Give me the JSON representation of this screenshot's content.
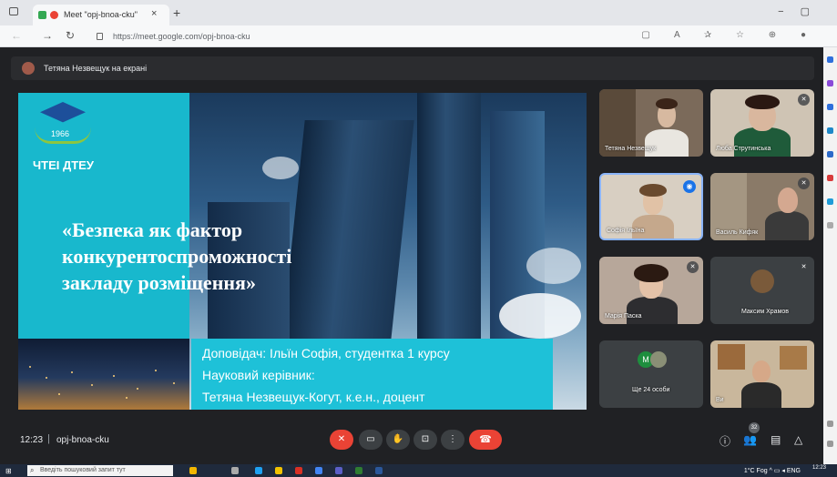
{
  "browser": {
    "tab_title": "Meet \"opj-bnoa-cku\"",
    "url": "https://meet.google.com/opj-bnoa-cku"
  },
  "meet": {
    "presenting_text": "Тетяна Незвещук на екрані",
    "slide": {
      "logo_year": "1966",
      "logo_text": "ЧТЕІ ДТЕУ",
      "title_lines": [
        "«Безпека як фактор",
        "конкурентоспроможності",
        "закладу розміщення»"
      ],
      "info_lines": [
        "Доповідач: Ільїн Софія, студентка 1 курсу",
        "Науковий керівник:",
        "Тетяна Незвещук-Когут, к.е.н., доцент"
      ]
    },
    "participants": [
      {
        "name": "Тетяна Незвещук"
      },
      {
        "name": "Люба Струтинська"
      },
      {
        "name": "Софія Ільїна"
      },
      {
        "name": "Василь Кифяк"
      },
      {
        "name": "Марія Паска"
      },
      {
        "name": "Максим Храмов"
      },
      {
        "name": "Ще 24 особи",
        "avatar_letter": "М"
      },
      {
        "name": "Ви"
      }
    ],
    "bottom_bar": {
      "time": "12:23",
      "meeting_code": "opj-bnoa-cku",
      "people_count": "32"
    }
  },
  "taskbar": {
    "search_placeholder": "Введіть пошуковий запит тут",
    "weather": "1°C Fog",
    "language": "ENG",
    "time": "12:23"
  }
}
